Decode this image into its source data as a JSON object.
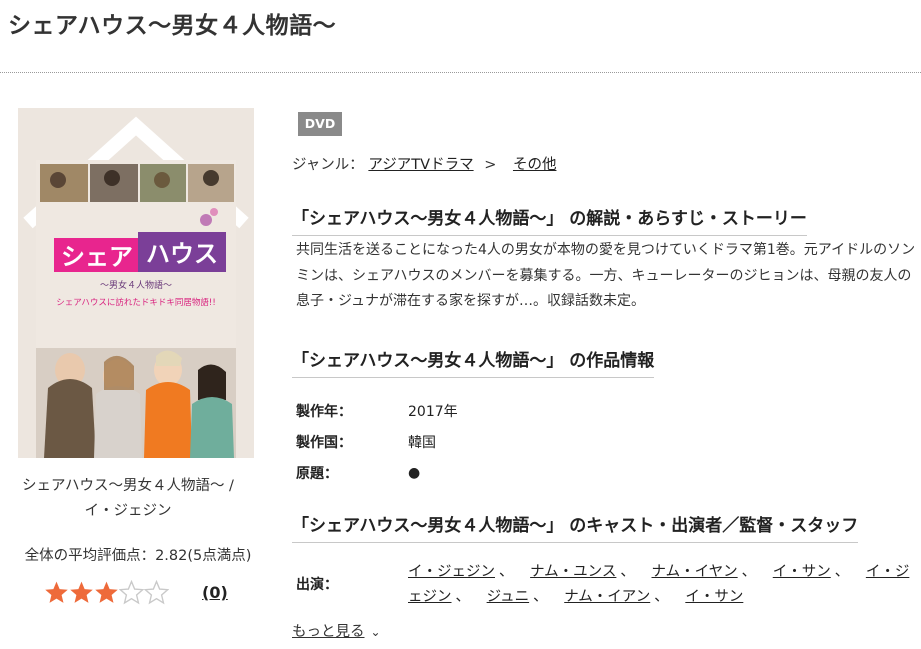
{
  "page": {
    "title": "シェアハウス〜男女４人物語〜"
  },
  "cover": {
    "art_title_pink": "シェア",
    "art_title_purple": "ハウス",
    "art_subtitle": "〜男女４人物語〜",
    "art_tagline": "シェアハウスに訪れたドキドキ同居物語!!",
    "caption": "シェアハウス〜男女４人物語〜 /\nイ・ジェジン"
  },
  "rating": {
    "text": "全体の平均評価点：2.82(5点満点)",
    "stars_filled": 3,
    "stars_total": 5,
    "review_count": "(0)",
    "colors": {
      "filled": "#ee6a3a",
      "empty": "#c9c9c9"
    }
  },
  "product": {
    "badge": "DVD",
    "genre_label": "ジャンル：",
    "genre_path": [
      "アジアTVドラマ",
      "その他"
    ],
    "genre_separator": ">"
  },
  "sections": {
    "story_heading": "「シェアハウス〜男女４人物語〜」 の解説・あらすじ・ストーリー",
    "story_text": "共同生活を送ることになった4人の男女が本物の愛を見つけていくドラマ第1巻。元アイドルのソンミンは、シェアハウスのメンバーを募集する。一方、キューレーターのジヒョンは、母親の友人の息子・ジュナが滞在する家を探すが…。収録話数未定。",
    "info_heading": "「シェアハウス〜男女４人物語〜」 の作品情報",
    "info": [
      {
        "label": "製作年：",
        "value": "2017年"
      },
      {
        "label": "製作国：",
        "value": "韓国"
      },
      {
        "label": "原題：",
        "value": "●"
      }
    ],
    "cast_heading": "「シェアハウス〜男女４人物語〜」 のキャスト・出演者／監督・スタッフ",
    "cast_label": "出演：",
    "cast": [
      "イ・ジェジン",
      "ナム・ユンス",
      "ナム・イヤン",
      "イ・サン",
      "イ・ジェジン",
      "ジュニ",
      "ナム・イアン",
      "イ・サン"
    ],
    "cast_separator": "、",
    "more_label": "もっと見る"
  }
}
